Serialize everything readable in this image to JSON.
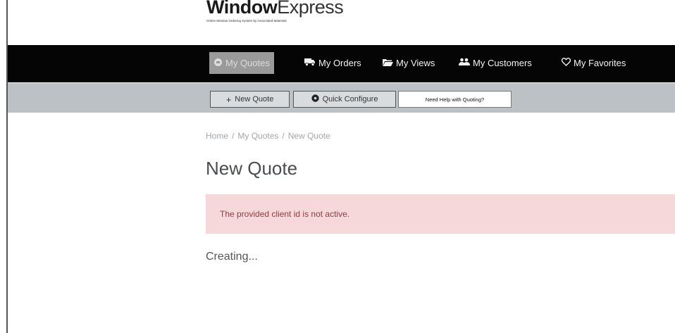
{
  "brand": {
    "logo_bold": "Window",
    "logo_light": "Express",
    "tagline": "Online Window Ordering System by Associated Materials"
  },
  "nav": {
    "items": [
      {
        "label": "My Quotes",
        "icon": "quotes-icon",
        "active": true
      },
      {
        "label": "My Orders",
        "icon": "truck-icon",
        "active": false
      },
      {
        "label": "My Views",
        "icon": "folder-open-icon",
        "active": false
      },
      {
        "label": "My Customers",
        "icon": "users-icon",
        "active": false
      },
      {
        "label": "My Favorites",
        "icon": "heart-icon",
        "active": false
      }
    ]
  },
  "toolbar": {
    "new_quote_label": "New Quote",
    "quick_configure_label": "Quick Configure",
    "help_label": "Need Help with Quoting?"
  },
  "breadcrumb": {
    "items": [
      "Home",
      "My Quotes",
      "New Quote"
    ],
    "separator": "/"
  },
  "page": {
    "title": "New Quote",
    "alert_message": "The provided client id is not active.",
    "status_text": "Creating..."
  },
  "colors": {
    "navbar_bg": "#050505",
    "nav_active_bg": "#9a9a9a",
    "toolbar_bg": "#bcc1c6",
    "alert_bg": "#f6d7da",
    "alert_text": "#8a3f44"
  }
}
